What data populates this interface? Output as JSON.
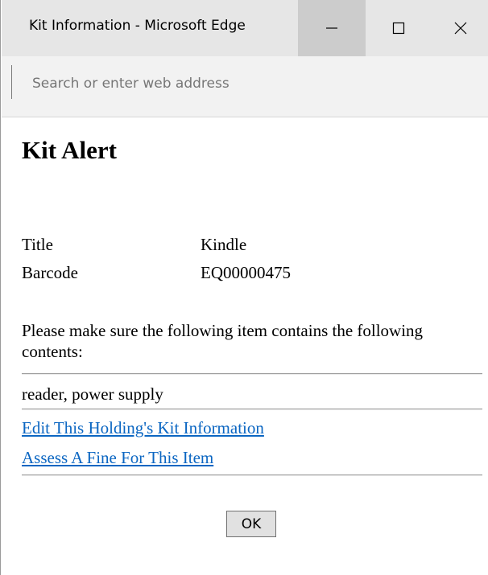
{
  "window": {
    "title": "Kit Information - Microsoft Edge",
    "controls": {
      "minimize_icon": "minimize-icon",
      "maximize_icon": "maximize-icon",
      "close_icon": "close-icon"
    }
  },
  "addressbar": {
    "placeholder": "Search or enter web address",
    "value": ""
  },
  "page": {
    "title": "Kit Alert",
    "info": [
      {
        "label": "Title",
        "value": "Kindle"
      },
      {
        "label": "Barcode",
        "value": "EQ00000475"
      }
    ],
    "message": "Please make sure the following item contains the following contents:",
    "contents": "reader, power supply",
    "links": {
      "edit_kit": "Edit This Holding's Kit Information",
      "assess_fine": "Assess A Fine For This Item"
    },
    "ok_label": "OK"
  },
  "colors": {
    "titlebar_bg": "#e6e6e6",
    "minimize_hover_bg": "#cccccc",
    "link": "#0b66c2"
  }
}
